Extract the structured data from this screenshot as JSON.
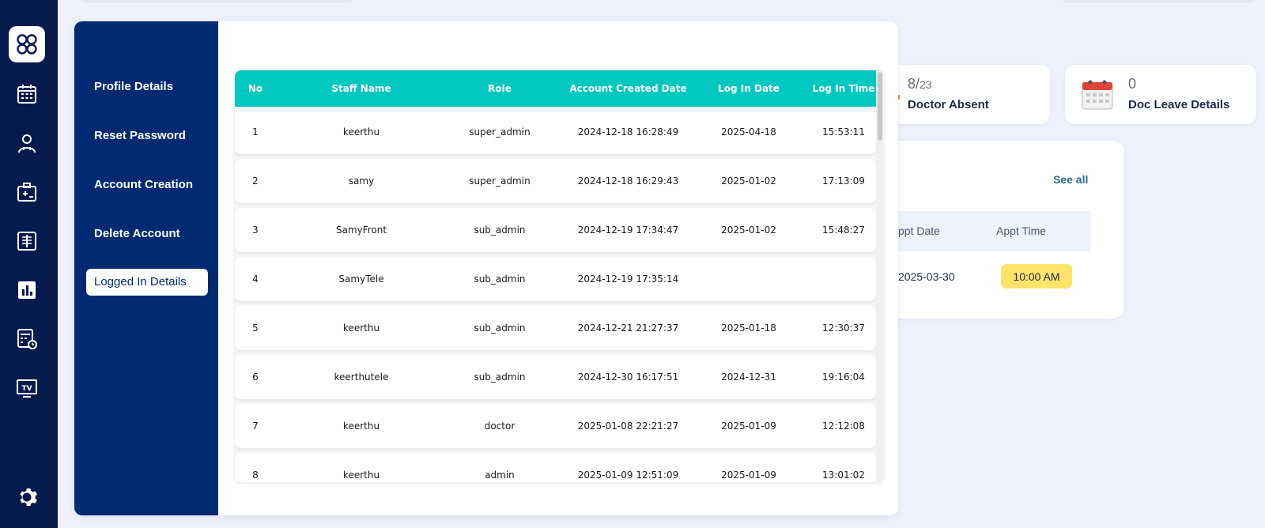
{
  "rail": {
    "items": [
      {
        "name": "dashboard-icon",
        "active": true
      },
      {
        "name": "calendar-icon",
        "active": false
      },
      {
        "name": "doctor-icon",
        "active": false
      },
      {
        "name": "medical-id-icon",
        "active": false
      },
      {
        "name": "xray-icon",
        "active": false
      },
      {
        "name": "bar-chart-icon",
        "active": false
      },
      {
        "name": "calculator-clock-icon",
        "active": false
      },
      {
        "name": "tv-icon",
        "active": false
      },
      {
        "name": "settings-icon",
        "active": false
      }
    ]
  },
  "stats": {
    "doctor_absent": {
      "count": "8/",
      "total": "23",
      "label": "Doctor Absent"
    },
    "doc_leave": {
      "count": "0",
      "label": "Doc Leave Details"
    }
  },
  "appointments": {
    "see_all": "See all",
    "col_date": "ppt Date",
    "col_time": "Appt Time",
    "row_date": "2025-03-30",
    "row_time": "10:00 AM"
  },
  "modal": {
    "nav": [
      {
        "label": "Profile Details",
        "active": false
      },
      {
        "label": "Reset Password",
        "active": false
      },
      {
        "label": "Account Creation",
        "active": false
      },
      {
        "label": "Delete Account",
        "active": false
      },
      {
        "label": "Logged In Details",
        "active": true
      }
    ],
    "table": {
      "headers": {
        "no": "No",
        "name": "Staff Name",
        "role": "Role",
        "created": "Account Created Date",
        "login_date": "Log In Date",
        "login_time": "Log In Time"
      },
      "rows": [
        {
          "no": "1",
          "name": "keerthu",
          "role": "super_admin",
          "created": "2024-12-18 16:28:49",
          "login_date": "2025-04-18",
          "login_time": "15:53:11"
        },
        {
          "no": "2",
          "name": "samy",
          "role": "super_admin",
          "created": "2024-12-18 16:29:43",
          "login_date": "2025-01-02",
          "login_time": "17:13:09"
        },
        {
          "no": "3",
          "name": "SamyFront",
          "role": "sub_admin",
          "created": "2024-12-19 17:34:47",
          "login_date": "2025-01-02",
          "login_time": "15:48:27"
        },
        {
          "no": "4",
          "name": "SamyTele",
          "role": "sub_admin",
          "created": "2024-12-19 17:35:14",
          "login_date": "",
          "login_time": ""
        },
        {
          "no": "5",
          "name": "keerthu",
          "role": "sub_admin",
          "created": "2024-12-21 21:27:37",
          "login_date": "2025-01-18",
          "login_time": "12:30:37"
        },
        {
          "no": "6",
          "name": "keerthutele",
          "role": "sub_admin",
          "created": "2024-12-30 16:17:51",
          "login_date": "2024-12-31",
          "login_time": "19:16:04"
        },
        {
          "no": "7",
          "name": "keerthu",
          "role": "doctor",
          "created": "2025-01-08 22:21:27",
          "login_date": "2025-01-09",
          "login_time": "12:12:08"
        },
        {
          "no": "8",
          "name": "keerthu",
          "role": "admin",
          "created": "2025-01-09 12:51:09",
          "login_date": "2025-01-09",
          "login_time": "13:01:02"
        }
      ]
    }
  },
  "colors": {
    "rail_bg": "#061a4d",
    "modal_nav_bg": "#012a72",
    "table_header_bg": "#00c8be",
    "appt_time_badge": "#fde36a"
  }
}
